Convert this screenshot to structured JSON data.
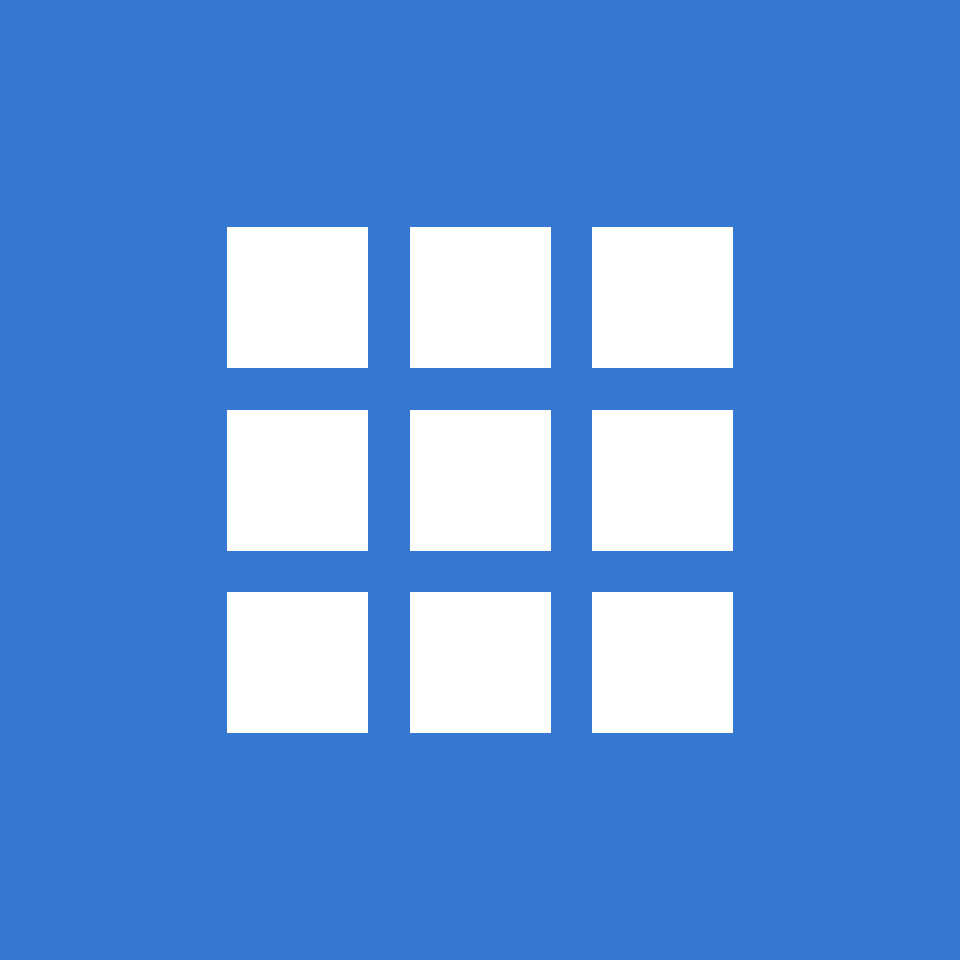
{
  "colors": {
    "background": "#3677D2",
    "tile": "#FFFFFF"
  },
  "icon": {
    "semantic_name": "grid-icon",
    "rows": 3,
    "columns": 3
  }
}
